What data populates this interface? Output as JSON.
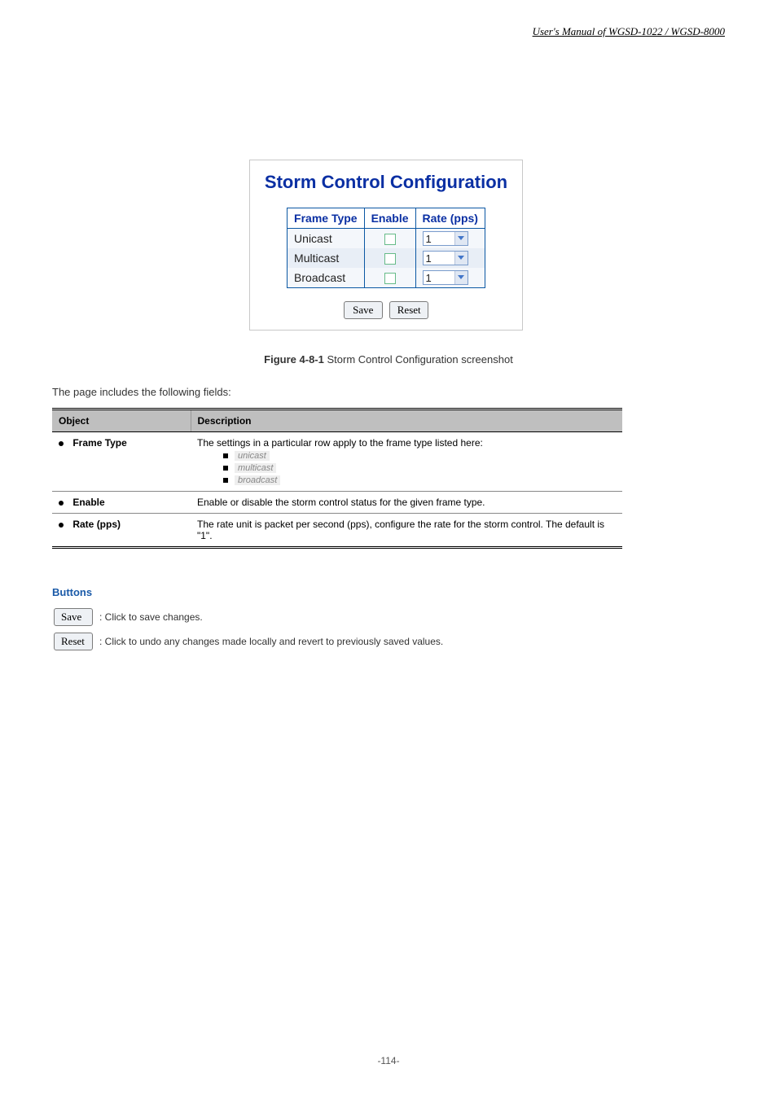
{
  "header": {
    "manual_label": "User's Manual of WGSD-1022 / WGSD-8000",
    "page_no_bottom": "-114-"
  },
  "screenshot": {
    "title": "Storm Control Configuration",
    "columns": {
      "c1": "Frame Type",
      "c2": "Enable",
      "c3": "Rate (pps)"
    },
    "rows": [
      {
        "type": "Unicast",
        "enabled": false,
        "rate": "1"
      },
      {
        "type": "Multicast",
        "enabled": false,
        "rate": "1"
      },
      {
        "type": "Broadcast",
        "enabled": false,
        "rate": "1"
      }
    ],
    "buttons": {
      "save": "Save",
      "reset": "Reset"
    }
  },
  "figure": {
    "label_bold": "Figure 4-8-1",
    "label_rest": "Storm Control Configuration screenshot"
  },
  "desc": {
    "intro": "The page includes the following fields:",
    "head": {
      "object": "Object",
      "description": "Description"
    },
    "rows": [
      {
        "object": "Frame Type",
        "desc_intro": "The settings in a particular row apply to the frame type listed here:",
        "list": [
          "unicast",
          "multicast",
          "broadcast"
        ]
      },
      {
        "object": "Enable",
        "desc": "Enable or disable the storm control status for the given frame type."
      },
      {
        "object": "Rate (pps)",
        "desc": "The rate unit is packet per second (pps), configure the rate for the storm control. The default is \"1\"."
      }
    ]
  },
  "buttons_section": {
    "title": "Buttons",
    "save": {
      "label": "Save",
      "desc": ": Click to save changes."
    },
    "reset": {
      "label": "Reset",
      "desc": ": Click to undo any changes made locally and revert to previously saved values."
    }
  }
}
